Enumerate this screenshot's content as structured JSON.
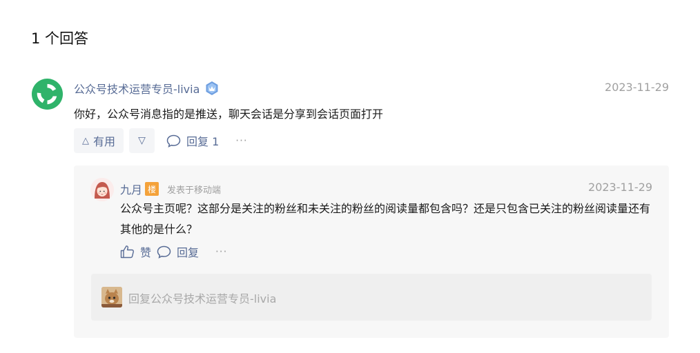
{
  "heading": "1 个回答",
  "answer": {
    "author": "公众号技术运营专员-livia",
    "date": "2023-11-29",
    "text": "你好，公众号消息指的是推送，聊天会话是分享到会话页面打开",
    "useful_label": "有用",
    "reply_label": "回复 1",
    "more_label": "···"
  },
  "reply": {
    "author": "九月",
    "floor_badge": "楼",
    "source": "发表于移动端",
    "date": "2023-11-29",
    "text": "公众号主页呢？这部分是关注的粉丝和未关注的粉丝的阅读量都包含吗？还是只包含已关注的粉丝阅读量还有其他的是什么？",
    "like_label": "赞",
    "reply_label": "回复",
    "more_label": "···"
  },
  "reply_input": {
    "placeholder": "回复公众号技术运营专员-livia"
  },
  "colors": {
    "link": "#576b95",
    "meta": "#a0a0a0",
    "brand_green": "#1aad19",
    "floor_badge": "#f4a23a"
  }
}
